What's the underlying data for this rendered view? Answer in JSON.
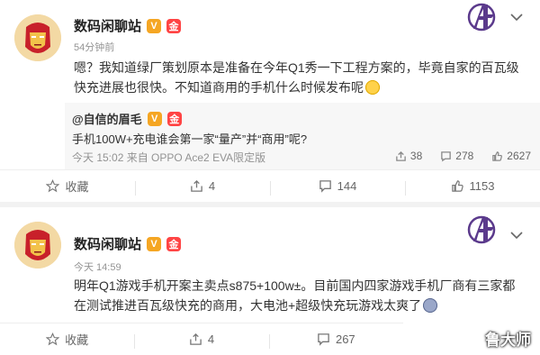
{
  "post1": {
    "author": "数码闲聊站",
    "time": "54分钟前",
    "content_line1": "嗯？我知道绿厂策划原本是准备在今年Q1秀一下工程方案的，毕竟自家的百瓦级",
    "content_line2": "快充进展也很快。不知道商用的手机什么时候发布呢",
    "repost": {
      "author": "@自信的眉毛",
      "text": "手机100W+充电谁会第一家“量产”并“商用”呢?",
      "meta": "今天 15:02 来自 OPPO Ace2 EVA限定版",
      "reposts": "38",
      "comments": "278",
      "likes": "2627"
    },
    "actions": {
      "favorite": "收藏",
      "share": "4",
      "comment": "144",
      "like": "1153"
    }
  },
  "post2": {
    "author": "数码闲聊站",
    "time": "今天 14:59",
    "content_line1": "明年Q1游戏手机开案主卖点s875+100w±。目前国内四家游戏手机厂商有三家都",
    "content_line2": "在测试推进百瓦级快充的商用，大电池+超级快充玩游戏太爽了",
    "actions": {
      "favorite": "收藏",
      "share": "4",
      "comment": "267"
    }
  },
  "badges": {
    "v": "V",
    "gold": "金"
  },
  "watermark": "鲁大师",
  "colors": {
    "v_badge": "#f5a623",
    "gold_badge": "#ff4444",
    "logo": "#5b3a8c",
    "meta_gray": "#939393"
  },
  "icons": [
    "iron-man-avatar",
    "avengers-logo-icon",
    "chevron-down-icon",
    "star-icon",
    "share-icon",
    "comment-icon",
    "thumb-up-icon"
  ]
}
